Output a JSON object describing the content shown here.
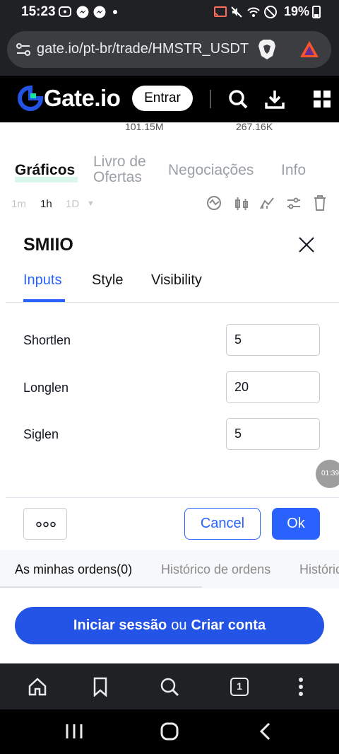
{
  "status_bar": {
    "time": "15:23",
    "battery": "19%"
  },
  "browser": {
    "url": "gate.io/pt-br/trade/HMSTR_USDT",
    "tab_count": "1"
  },
  "header": {
    "logo": "Gate.io",
    "login_button": "Entrar"
  },
  "market_stats": {
    "stat_1": "101.15M",
    "stat_2": "267.16K"
  },
  "main_tabs": [
    {
      "label": "Gráficos",
      "active": true
    },
    {
      "label": "Livro de Ofertas",
      "active": false
    },
    {
      "label": "Negociações",
      "active": false
    },
    {
      "label": "Info",
      "active": false
    }
  ],
  "timeframes": [
    "1m",
    "1h",
    "1D"
  ],
  "modal": {
    "title": "SMIIO",
    "tabs": [
      {
        "label": "Inputs",
        "active": true
      },
      {
        "label": "Style",
        "active": false
      },
      {
        "label": "Visibility",
        "active": false
      }
    ],
    "fields": [
      {
        "label": "Shortlen",
        "value": "5"
      },
      {
        "label": "Longlen",
        "value": "20"
      },
      {
        "label": "Siglen",
        "value": "5"
      }
    ],
    "more_button": "ooo",
    "cancel_button": "Cancel",
    "ok_button": "Ok",
    "time_bubble": "01:39"
  },
  "orders": {
    "tabs": [
      "As minhas ordens(0)",
      "Histórico de ordens",
      "Histórico"
    ]
  },
  "login_cta": {
    "login": "Iniciar sessão",
    "or": "ou",
    "register": "Criar conta"
  },
  "colors": {
    "accent": "#2962ff",
    "cta": "#2354e6",
    "brand": "#2354e6"
  }
}
